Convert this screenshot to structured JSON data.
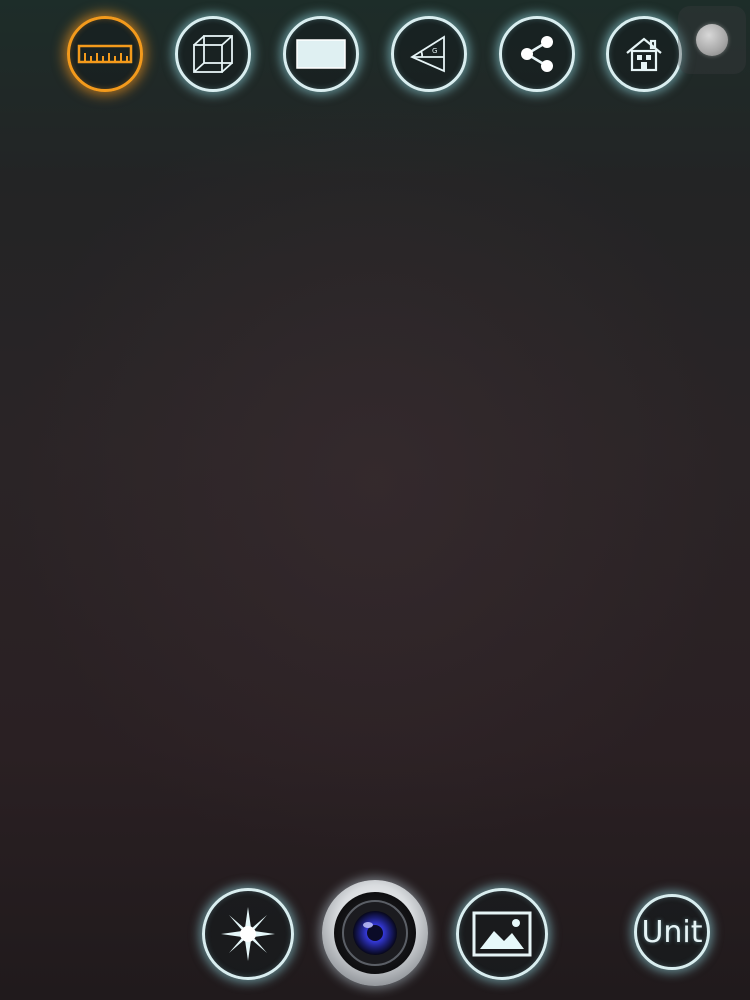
{
  "toolbar": {
    "items": [
      {
        "name": "ruler-tool",
        "icon": "ruler-icon",
        "active": true
      },
      {
        "name": "cube-tool",
        "icon": "cube-icon",
        "active": false
      },
      {
        "name": "rectangle-tool",
        "icon": "rectangle-icon",
        "active": false
      },
      {
        "name": "angle-tool",
        "icon": "angle-icon",
        "active": false
      },
      {
        "name": "share-tool",
        "icon": "share-icon",
        "active": false
      },
      {
        "name": "home-tool",
        "icon": "home-icon",
        "active": false
      }
    ]
  },
  "bottom_bar": {
    "unit_label": "Unit"
  },
  "colors": {
    "accent_active": "#f39a1c",
    "icon_outline": "#d9eef0",
    "lens_blue": "#3b3ff0"
  }
}
